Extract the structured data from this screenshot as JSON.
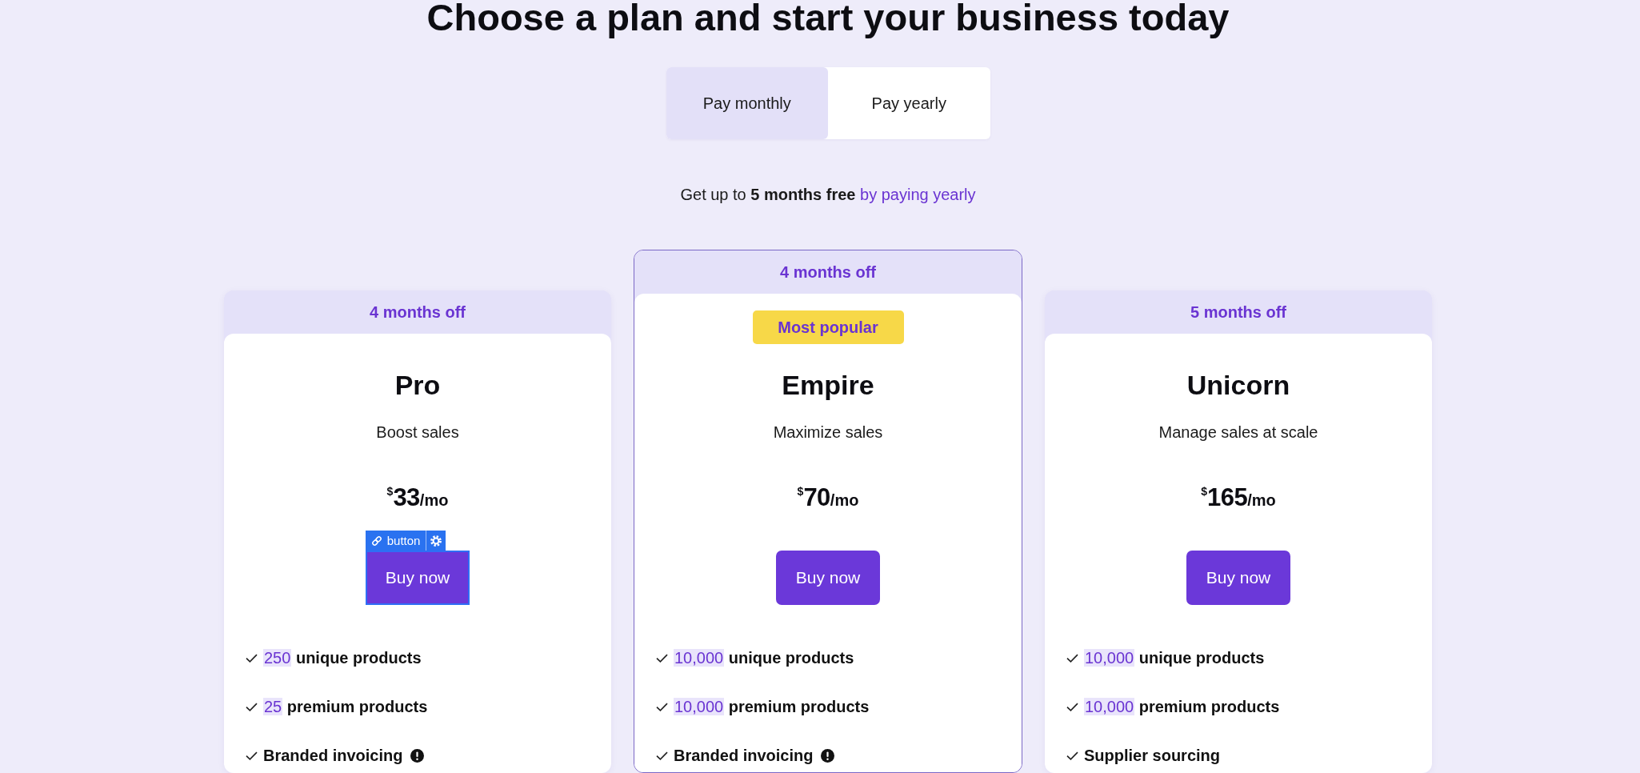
{
  "page": {
    "title": "Choose a plan and start your business today"
  },
  "billing_toggle": [
    {
      "label": "Pay monthly",
      "selected": true
    },
    {
      "label": "Pay yearly",
      "selected": false
    }
  ],
  "savings_note": {
    "text": "Get up to **5 months free**",
    "link": "by paying yearly"
  },
  "plans": [
    {
      "discount": "4 months off",
      "featured": false,
      "name": "Pro",
      "tagline": "Boost sales",
      "price": {
        "currency": "$",
        "amount": "33",
        "period": "/mo"
      },
      "button": {
        "label": "Buy now",
        "selected": true,
        "editor_tag": "button"
      },
      "features": [
        {
          "amount": "250",
          "text": "unique products",
          "info": false
        },
        {
          "amount": "25",
          "text": "premium products",
          "info": false
        },
        {
          "text": "Branded invoicing",
          "info": true
        }
      ]
    },
    {
      "discount": "4 months off",
      "featured": true,
      "badge": "Most popular",
      "name": "Empire",
      "tagline": "Maximize sales",
      "price": {
        "currency": "$",
        "amount": "70",
        "period": "/mo"
      },
      "button": {
        "label": "Buy now",
        "selected": false
      },
      "features": [
        {
          "amount": "10,000",
          "text": "unique products",
          "info": false
        },
        {
          "amount": "10,000",
          "text": "premium products",
          "info": false
        },
        {
          "text": "Branded invoicing",
          "info": true
        }
      ]
    },
    {
      "discount": "5 months off",
      "featured": false,
      "name": "Unicorn",
      "tagline": "Manage sales at scale",
      "price": {
        "currency": "$",
        "amount": "165",
        "period": "/mo"
      },
      "button": {
        "label": "Buy now",
        "selected": false
      },
      "features": [
        {
          "amount": "10,000",
          "text": "unique products",
          "info": false
        },
        {
          "amount": "10,000",
          "text": "premium products",
          "info": false
        },
        {
          "text": "Supplier sourcing",
          "info": false
        }
      ]
    }
  ]
}
